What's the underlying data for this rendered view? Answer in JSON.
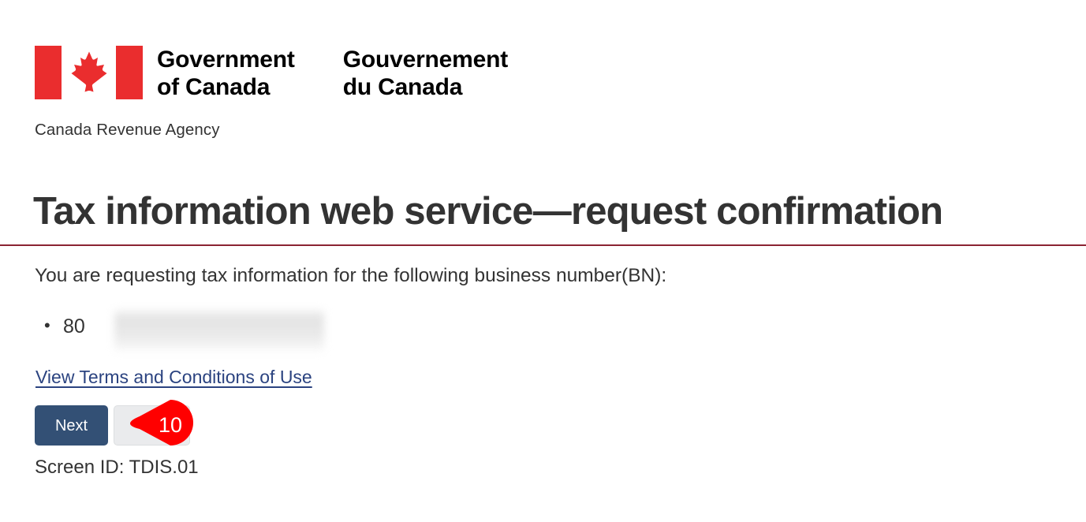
{
  "header": {
    "flag_icon": "canada-flag-icon",
    "wordmark_en_line1": "Government",
    "wordmark_en_line2": "of Canada",
    "wordmark_fr_line1": "Gouvernement",
    "wordmark_fr_line2": "du Canada",
    "department": "Canada Revenue Agency"
  },
  "main": {
    "title": "Tax information web service—request confirmation",
    "intro": "You are requesting tax information for the following business number(BN):",
    "business_numbers": [
      {
        "visible_prefix": "80",
        "redacted": true
      }
    ],
    "terms_link": "View Terms and Conditions of Use",
    "next_button": "Next",
    "secondary_button": "",
    "screen_id": "Screen ID: TDIS.01"
  },
  "annotation": {
    "marker_number": "10",
    "marker_color": "#FF0000"
  },
  "colors": {
    "flag_red": "#EA2D2E",
    "title_rule": "#8B2332",
    "primary_button": "#335075",
    "link": "#2B4380",
    "text": "#333333"
  }
}
